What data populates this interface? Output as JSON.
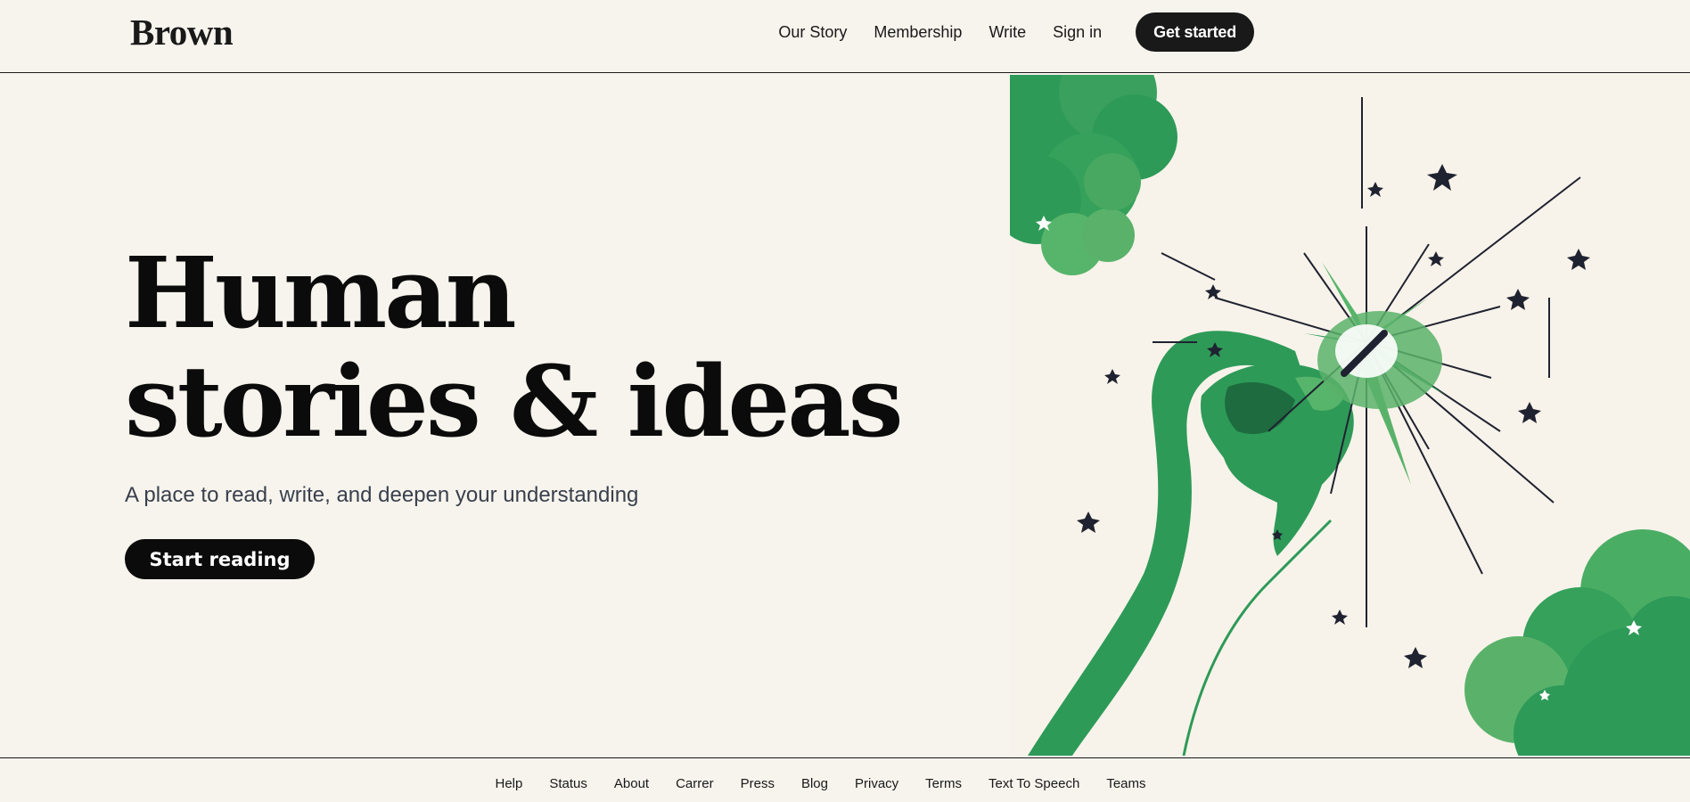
{
  "header": {
    "logo": "Brown",
    "nav": {
      "our_story": "Our Story",
      "membership": "Membership",
      "write": "Write",
      "sign_in": "Sign in",
      "get_started": "Get started"
    }
  },
  "hero": {
    "title_line1": "Human",
    "title_line2": "stories & ideas",
    "subtitle": "A place to read, write, and deepen your understanding",
    "cta": "Start reading"
  },
  "illustration": {
    "icon": "hand-holding-pen-sparkle-illustration",
    "colors": {
      "green_light": "#5ab26a",
      "green": "#2e9a58",
      "green_dark": "#1d6b3e",
      "ink": "#1f2230",
      "background": "#f8f3ea"
    }
  },
  "footer": {
    "links": [
      "Help",
      "Status",
      "About",
      "Carrer",
      "Press",
      "Blog",
      "Privacy",
      "Terms",
      "Text To Speech",
      "Teams"
    ]
  },
  "colors": {
    "page_background": "#f7f4ed",
    "text": "#191919",
    "button": "#191919",
    "subtitle": "#39404d"
  }
}
